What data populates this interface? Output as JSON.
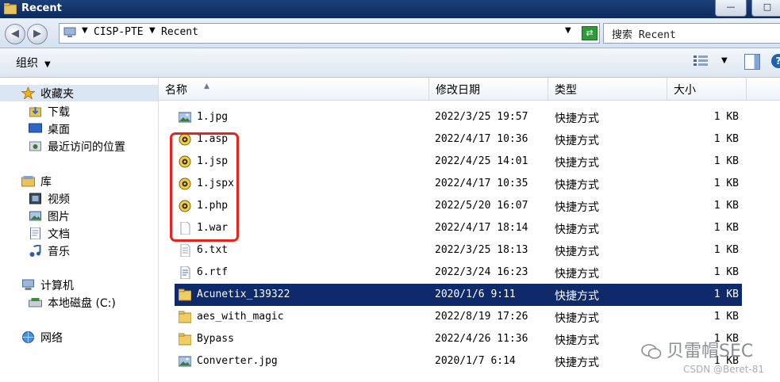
{
  "window": {
    "title": "Recent",
    "min_label": "—",
    "max_label": "□"
  },
  "address": {
    "path": [
      "CISP-PTE",
      "Recent"
    ],
    "search_placeholder": "搜索 Recent"
  },
  "toolbar": {
    "organize_label": "组织"
  },
  "sidebar": {
    "favorites": {
      "label": "收藏夹",
      "icon": "star-icon",
      "items": [
        {
          "label": "下载",
          "icon": "downloads-folder-icon"
        },
        {
          "label": "桌面",
          "icon": "desktop-icon"
        },
        {
          "label": "最近访问的位置",
          "icon": "recent-places-icon"
        }
      ]
    },
    "libraries": {
      "label": "库",
      "icon": "library-icon",
      "items": [
        {
          "label": "视频",
          "icon": "video-icon"
        },
        {
          "label": "图片",
          "icon": "pictures-icon"
        },
        {
          "label": "文档",
          "icon": "documents-icon"
        },
        {
          "label": "音乐",
          "icon": "music-icon"
        }
      ]
    },
    "computer": {
      "label": "计算机",
      "icon": "computer-icon",
      "items": [
        {
          "label": "本地磁盘 (C:)",
          "icon": "drive-icon"
        }
      ]
    },
    "network": {
      "label": "网络",
      "icon": "network-icon"
    }
  },
  "columns": {
    "name": "名称",
    "date": "修改日期",
    "type": "类型",
    "size": "大小"
  },
  "files": [
    {
      "name": "1.jpg",
      "date": "2022/3/25 19:57",
      "type": "快捷方式",
      "size": "1 KB",
      "icon": "image-icon"
    },
    {
      "name": "1.asp",
      "date": "2022/4/17 10:36",
      "type": "快捷方式",
      "size": "1 KB",
      "icon": "script-icon"
    },
    {
      "name": "1.jsp",
      "date": "2022/4/25 14:01",
      "type": "快捷方式",
      "size": "1 KB",
      "icon": "script-icon"
    },
    {
      "name": "1.jspx",
      "date": "2022/4/17 10:35",
      "type": "快捷方式",
      "size": "1 KB",
      "icon": "script-icon"
    },
    {
      "name": "1.php",
      "date": "2022/5/20 16:07",
      "type": "快捷方式",
      "size": "1 KB",
      "icon": "script-icon"
    },
    {
      "name": "1.war",
      "date": "2022/4/17 18:14",
      "type": "快捷方式",
      "size": "1 KB",
      "icon": "blank-file-icon"
    },
    {
      "name": "6.txt",
      "date": "2022/3/25 18:13",
      "type": "快捷方式",
      "size": "1 KB",
      "icon": "text-file-icon"
    },
    {
      "name": "6.rtf",
      "date": "2022/3/24 16:23",
      "type": "快捷方式",
      "size": "1 KB",
      "icon": "rtf-file-icon"
    },
    {
      "name": "Acunetix_139322",
      "date": "2020/1/6 9:11",
      "type": "快捷方式",
      "size": "1 KB",
      "icon": "folder-icon",
      "selected": true
    },
    {
      "name": "aes_with_magic",
      "date": "2022/8/19 17:26",
      "type": "快捷方式",
      "size": "1 KB",
      "icon": "folder-icon"
    },
    {
      "name": "Bypass",
      "date": "2022/4/26 11:36",
      "type": "快捷方式",
      "size": "1 KB",
      "icon": "folder-icon"
    },
    {
      "name": "Converter.jpg",
      "date": "2020/1/7 6:14",
      "type": "快捷方式",
      "size": "1 KB",
      "icon": "image-icon"
    }
  ],
  "watermark": {
    "brand": "贝雷帽SEC",
    "credit": "CSDN @Beret-81"
  },
  "colors": {
    "selection": "#0f2a6b",
    "highlight_box": "#e8231e",
    "titlebar": "#1c3f7a"
  }
}
